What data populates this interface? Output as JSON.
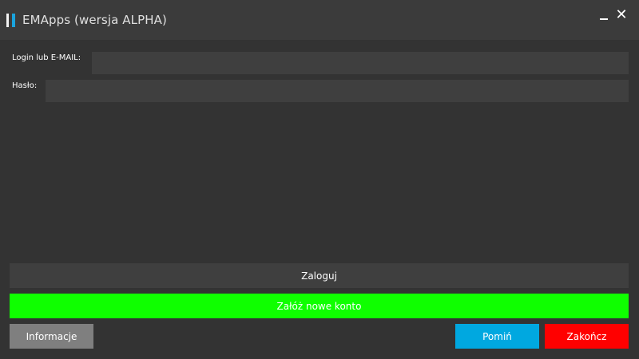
{
  "window": {
    "title": "EMApps (wersja ALPHA)",
    "minimize_icon": "minimize-icon",
    "close_icon": "close-icon",
    "close_glyph": "✕"
  },
  "form": {
    "login_label": "Login lub E-MAIL:",
    "login_value": "",
    "password_label": "Hasło:",
    "password_value": ""
  },
  "buttons": {
    "login": "Zaloguj",
    "register": "Załóż nowe konto",
    "info": "Informacje",
    "skip": "Pomiń",
    "exit": "Zakończ"
  },
  "colors": {
    "background": "#333333",
    "titlebar": "#3b3b3b",
    "input": "#3f3f3f",
    "login_button": "#3f3f3f",
    "register_button": "#0fff00",
    "info_button": "#7f7f7f",
    "skip_button": "#00a8e0",
    "exit_button": "#ff0000",
    "logo_accent": "#1aa3dd"
  }
}
